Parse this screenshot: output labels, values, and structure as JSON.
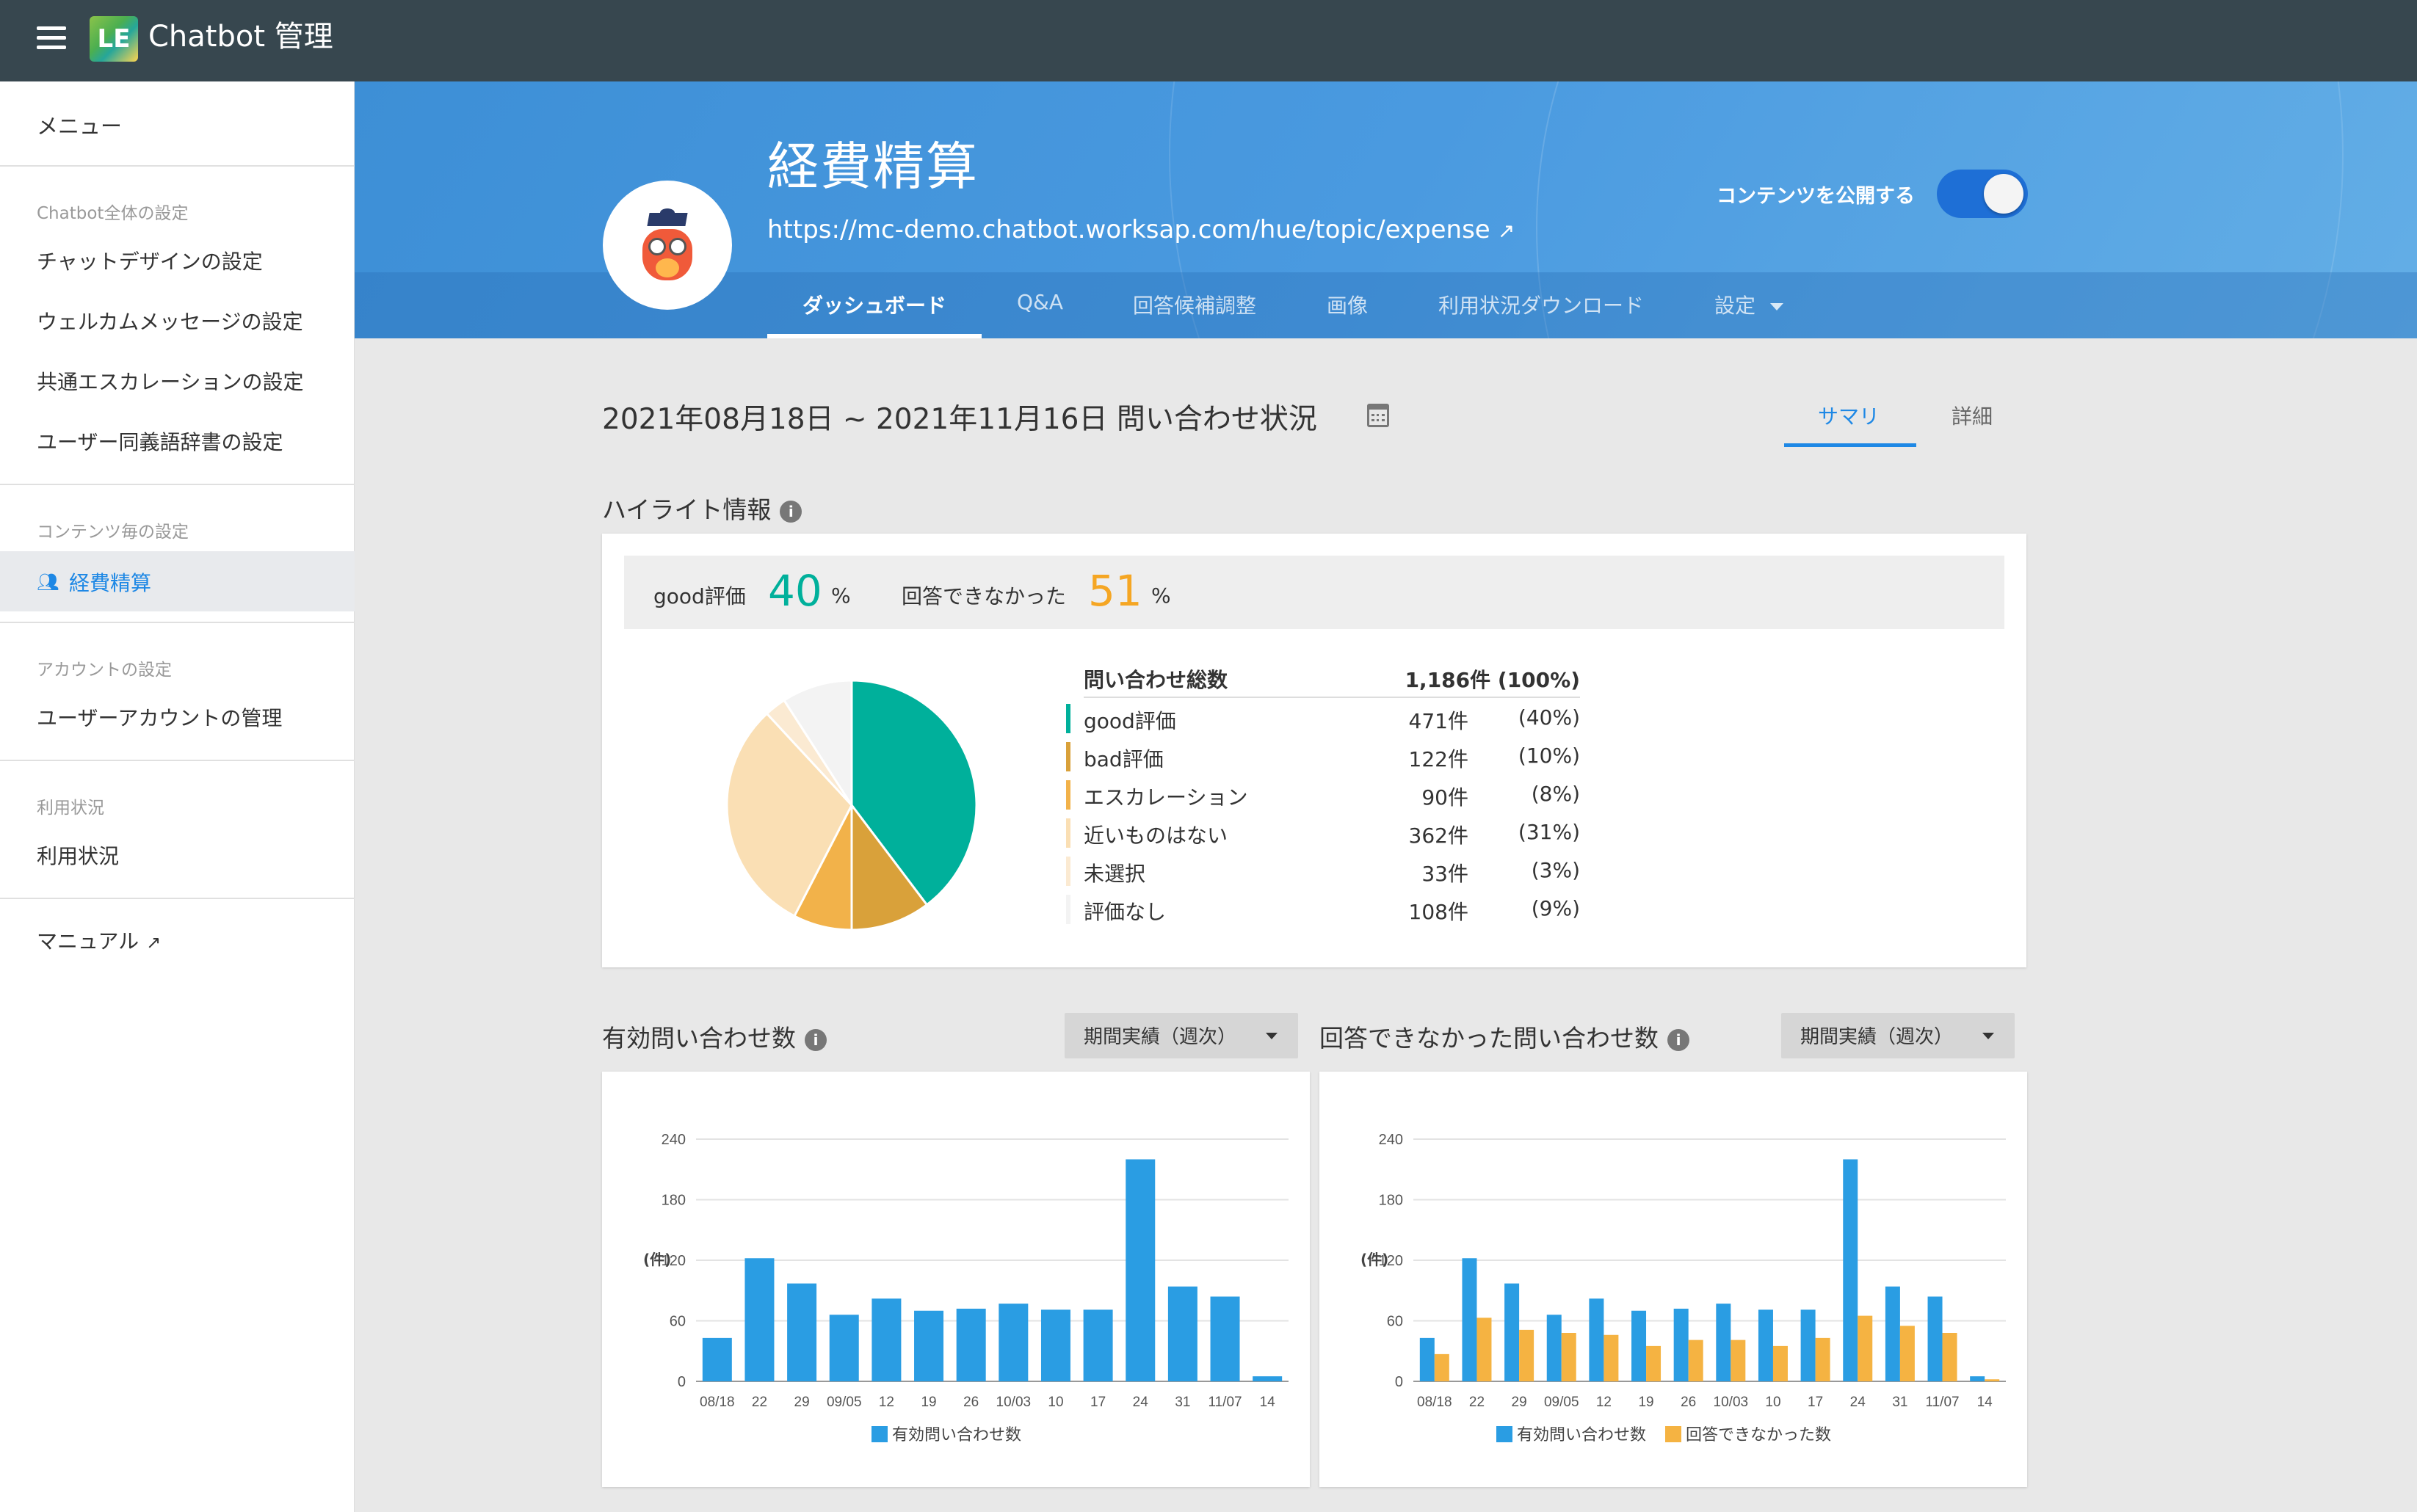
{
  "app": {
    "title": "Chatbot 管理",
    "logo_text": "LE"
  },
  "sidebar": {
    "menu_title": "メニュー",
    "section_global": "Chatbot全体の設定",
    "items_global": [
      "チャットデザインの設定",
      "ウェルカムメッセージの設定",
      "共通エスカレーションの設定",
      "ユーザー同義語辞書の設定"
    ],
    "section_content": "コンテンツ毎の設定",
    "active_item": "経費精算",
    "section_account": "アカウントの設定",
    "item_account": "ユーザーアカウントの管理",
    "section_usage": "利用状況",
    "item_usage": "利用状況",
    "item_manual": "マニュアル"
  },
  "header": {
    "title": "経費精算",
    "url": "https://mc-demo.chatbot.worksap.com/hue/topic/expense",
    "publish_label": "コンテンツを公開する",
    "publish_on": true,
    "tabs": [
      {
        "label": "ダッシュボード",
        "active": true
      },
      {
        "label": "Q&A"
      },
      {
        "label": "回答候補調整"
      },
      {
        "label": "画像"
      },
      {
        "label": "利用状況ダウンロード"
      },
      {
        "label": "設定"
      }
    ]
  },
  "main": {
    "date_range": "2021年08月18日 ~ 2021年11月16日 問い合わせ状況",
    "view_tabs": {
      "summary": "サマリ",
      "detail": "詳細"
    }
  },
  "highlight": {
    "title": "ハイライト情報",
    "good_label": "good評価",
    "good_value": "40",
    "unanswered_label": "回答できなかった",
    "unanswered_value": "51",
    "pct_sign": "%",
    "total_label": "問い合わせ総数",
    "total_value": "1,186件 (100%)",
    "rows": [
      {
        "name": "good評価",
        "count": "471件",
        "pct": "(40%)",
        "color": "#00b09b"
      },
      {
        "name": "bad評価",
        "count": "122件",
        "pct": "(10%)",
        "color": "#d9a13a"
      },
      {
        "name": "エスカレーション",
        "count": "90件",
        "pct": "(8%)",
        "color": "#f2b24a"
      },
      {
        "name": "近いものはない",
        "count": "362件",
        "pct": "(31%)",
        "color": "#fadfb4"
      },
      {
        "name": "未選択",
        "count": "33件",
        "pct": "(3%)",
        "color": "#fbead2"
      },
      {
        "name": "評価なし",
        "count": "108件",
        "pct": "(9%)",
        "color": "#f3f3f3"
      }
    ]
  },
  "charts": {
    "left_title": "有効問い合わせ数",
    "right_title": "回答できなかった問い合わせ数",
    "dropdown_label": "期間実績（週次）",
    "y_unit": "(件)"
  },
  "chart_data": [
    {
      "type": "pie",
      "categories": [
        "good評価",
        "bad評価",
        "エスカレーション",
        "近いものはない",
        "未選択",
        "評価なし"
      ],
      "values": [
        471,
        122,
        90,
        362,
        33,
        108
      ],
      "colors": [
        "#00b09b",
        "#d9a13a",
        "#f2b24a",
        "#fadfb4",
        "#fbead2",
        "#f3f3f3"
      ]
    },
    {
      "type": "bar",
      "categories": [
        "08/18",
        "22",
        "29",
        "09/05",
        "12",
        "19",
        "26",
        "10/03",
        "10",
        "17",
        "24",
        "31",
        "11/07",
        "14"
      ],
      "series": [
        {
          "name": "有効問い合わせ数",
          "color": "#2a9de3",
          "values": [
            43,
            122,
            97,
            66,
            82,
            70,
            72,
            77,
            71,
            71,
            220,
            94,
            84,
            5
          ]
        }
      ],
      "ylim": [
        0,
        240
      ],
      "yticks": [
        0,
        60,
        120,
        180,
        240
      ],
      "ylabel": "(件)",
      "legend": "bottom"
    },
    {
      "type": "bar",
      "categories": [
        "08/18",
        "22",
        "29",
        "09/05",
        "12",
        "19",
        "26",
        "10/03",
        "10",
        "17",
        "24",
        "31",
        "11/07",
        "14"
      ],
      "series": [
        {
          "name": "有効問い合わせ数",
          "color": "#2a9de3",
          "values": [
            43,
            122,
            97,
            66,
            82,
            70,
            72,
            77,
            71,
            71,
            220,
            94,
            84,
            5
          ]
        },
        {
          "name": "回答できなかった数",
          "color": "#f5b342",
          "values": [
            27,
            63,
            51,
            48,
            46,
            35,
            41,
            41,
            35,
            43,
            65,
            55,
            48,
            2
          ]
        }
      ],
      "ylim": [
        0,
        240
      ],
      "yticks": [
        0,
        60,
        120,
        180,
        240
      ],
      "ylabel": "(件)",
      "legend": "bottom"
    }
  ]
}
